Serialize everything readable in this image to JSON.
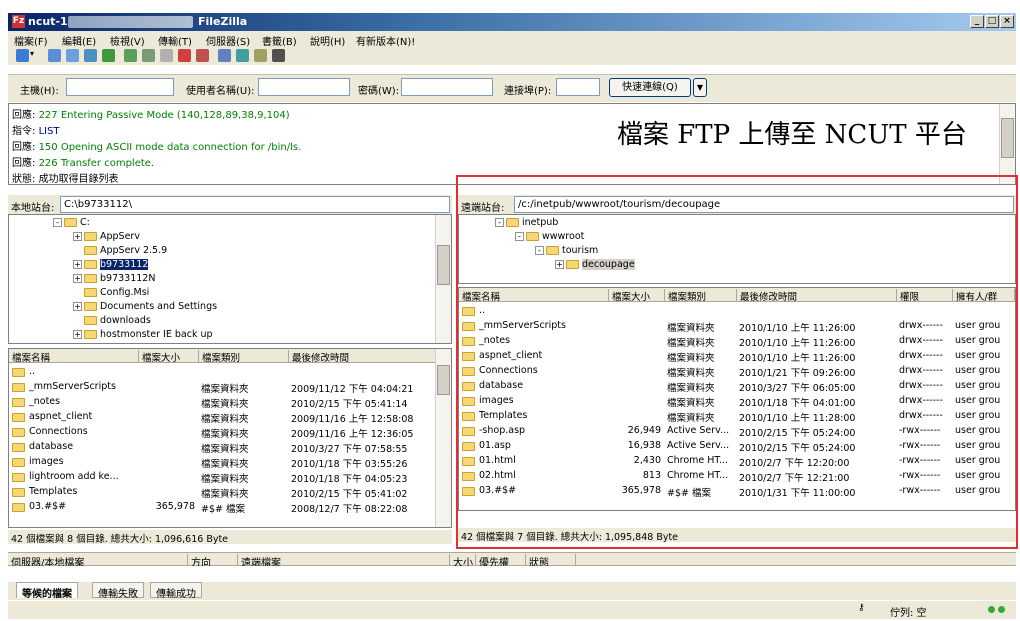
{
  "window": {
    "title": "ncut-1 - ",
    "app": "FileZilla",
    "controls": [
      "_",
      "□",
      "×"
    ]
  },
  "menu": [
    "檔案(F)",
    "編輯(E)",
    "檢視(V)",
    "傳輸(T)",
    "伺服器(S)",
    "書籤(B)",
    "說明(H)",
    "有新版本(N)!"
  ],
  "quickconnect": {
    "host_label": "主機(H):",
    "user_label": "使用者名稱(U):",
    "pass_label": "密碼(W):",
    "port_label": "連接埠(P):",
    "button": "快速連線(Q)",
    "dropdown": "▼"
  },
  "log": [
    {
      "prefix": "回應:",
      "text": "227 Entering Passive Mode (140,128,89,38,9,104)",
      "kind": "resp"
    },
    {
      "prefix": "指令:",
      "text": "LIST",
      "kind": "cmd"
    },
    {
      "prefix": "回應:",
      "text": "150 Opening ASCII mode data connection for /bin/ls.",
      "kind": "resp"
    },
    {
      "prefix": "回應:",
      "text": "226 Transfer complete.",
      "kind": "resp"
    },
    {
      "prefix": "狀態:",
      "text": "成功取得目錄列表",
      "kind": "stat"
    }
  ],
  "banner": "檔案 FTP 上傳至 NCUT 平台",
  "local": {
    "site_label": "本地站台:",
    "site_value": "C:\\b9733112\\",
    "tree": [
      {
        "label": "C:",
        "indent": 0,
        "exp": "-"
      },
      {
        "label": "AppServ",
        "indent": 1,
        "exp": "+"
      },
      {
        "label": "AppServ 2.5.9",
        "indent": 1,
        "exp": ""
      },
      {
        "label": "b9733112",
        "indent": 1,
        "exp": "+",
        "selected": true
      },
      {
        "label": "b9733112N",
        "indent": 1,
        "exp": "+"
      },
      {
        "label": "Config.Msi",
        "indent": 1,
        "exp": ""
      },
      {
        "label": "Documents and Settings",
        "indent": 1,
        "exp": "+"
      },
      {
        "label": "downloads",
        "indent": 1,
        "exp": ""
      },
      {
        "label": "hostmonster IE back up",
        "indent": 1,
        "exp": "+"
      }
    ],
    "headers": [
      "檔案名稱",
      "檔案大小",
      "檔案類別",
      "最後修改時間"
    ],
    "files": [
      {
        "name": "..",
        "size": "",
        "type": "",
        "date": ""
      },
      {
        "name": "_mmServerScripts",
        "size": "",
        "type": "檔案資料夾",
        "date": "2009/11/12 下午 04:04:21"
      },
      {
        "name": "_notes",
        "size": "",
        "type": "檔案資料夾",
        "date": "2010/2/15 下午 05:41:14"
      },
      {
        "name": "aspnet_client",
        "size": "",
        "type": "檔案資料夾",
        "date": "2009/11/16 上午 12:58:08"
      },
      {
        "name": "Connections",
        "size": "",
        "type": "檔案資料夾",
        "date": "2009/11/16 上午 12:36:05"
      },
      {
        "name": "database",
        "size": "",
        "type": "檔案資料夾",
        "date": "2010/3/27 下午 07:58:55"
      },
      {
        "name": "images",
        "size": "",
        "type": "檔案資料夾",
        "date": "2010/1/18 下午 03:55:26"
      },
      {
        "name": "lightroom add ke...",
        "size": "",
        "type": "檔案資料夾",
        "date": "2010/1/18 下午 04:05:23"
      },
      {
        "name": "Templates",
        "size": "",
        "type": "檔案資料夾",
        "date": "2010/2/15 下午 05:41:02"
      },
      {
        "name": "03.#$#",
        "size": "365,978",
        "type": "#$# 檔案",
        "date": "2008/12/7 下午 08:22:08"
      }
    ],
    "status": "42 個檔案與 8 個目錄. 總共大小: 1,096,616 Byte"
  },
  "remote": {
    "site_label": "遠端站台:",
    "site_value": "/c:/inetpub/wwwroot/tourism/decoupage",
    "tree": [
      {
        "label": "inetpub",
        "indent": 0,
        "exp": "-"
      },
      {
        "label": "wwwroot",
        "indent": 1,
        "exp": "-"
      },
      {
        "label": "tourism",
        "indent": 2,
        "exp": "-"
      },
      {
        "label": "decoupage",
        "indent": 3,
        "exp": "+",
        "selected": true
      }
    ],
    "headers": [
      "檔案名稱",
      "檔案大小",
      "檔案類別",
      "最後修改時間",
      "權限",
      "擁有人/群"
    ],
    "files": [
      {
        "name": "..",
        "size": "",
        "type": "",
        "date": "",
        "perm": "",
        "owner": ""
      },
      {
        "name": "_mmServerScripts",
        "size": "",
        "type": "檔案資料夾",
        "date": "2010/1/10 上午 11:26:00",
        "perm": "drwx------",
        "owner": "user grou"
      },
      {
        "name": "_notes",
        "size": "",
        "type": "檔案資料夾",
        "date": "2010/1/10 上午 11:26:00",
        "perm": "drwx------",
        "owner": "user grou"
      },
      {
        "name": "aspnet_client",
        "size": "",
        "type": "檔案資料夾",
        "date": "2010/1/10 上午 11:26:00",
        "perm": "drwx------",
        "owner": "user grou"
      },
      {
        "name": "Connections",
        "size": "",
        "type": "檔案資料夾",
        "date": "2010/1/21 下午 09:26:00",
        "perm": "drwx------",
        "owner": "user grou"
      },
      {
        "name": "database",
        "size": "",
        "type": "檔案資料夾",
        "date": "2010/3/27 下午 06:05:00",
        "perm": "drwx------",
        "owner": "user grou"
      },
      {
        "name": "images",
        "size": "",
        "type": "檔案資料夾",
        "date": "2010/1/18 下午 04:01:00",
        "perm": "drwx------",
        "owner": "user grou"
      },
      {
        "name": "Templates",
        "size": "",
        "type": "檔案資料夾",
        "date": "2010/1/10 上午 11:28:00",
        "perm": "drwx------",
        "owner": "user grou"
      },
      {
        "name": "-shop.asp",
        "size": "26,949",
        "type": "Active Serv...",
        "date": "2010/2/15 下午 05:24:00",
        "perm": "-rwx------",
        "owner": "user grou"
      },
      {
        "name": "01.asp",
        "size": "16,938",
        "type": "Active Serv...",
        "date": "2010/2/15 下午 05:24:00",
        "perm": "-rwx------",
        "owner": "user grou"
      },
      {
        "name": "01.html",
        "size": "2,430",
        "type": "Chrome HT...",
        "date": "2010/2/7 下午 12:20:00",
        "perm": "-rwx------",
        "owner": "user grou"
      },
      {
        "name": "02.html",
        "size": "813",
        "type": "Chrome HT...",
        "date": "2010/2/7 下午 12:21:00",
        "perm": "-rwx------",
        "owner": "user grou"
      },
      {
        "name": "03.#$#",
        "size": "365,978",
        "type": "#$# 檔案",
        "date": "2010/1/31 下午 11:00:00",
        "perm": "-rwx------",
        "owner": "user grou"
      }
    ],
    "status": "42 個檔案與 7 個目錄. 總共大小: 1,095,848 Byte"
  },
  "queue": {
    "headers": [
      "伺服器/本地檔案",
      "方向",
      "遠端檔案",
      "大小",
      "優先權",
      "狀態"
    ],
    "tabs": [
      "等候的檔案",
      "傳輸失敗",
      "傳輸成功"
    ]
  },
  "statusbar": {
    "queue": "佇列: 空"
  }
}
